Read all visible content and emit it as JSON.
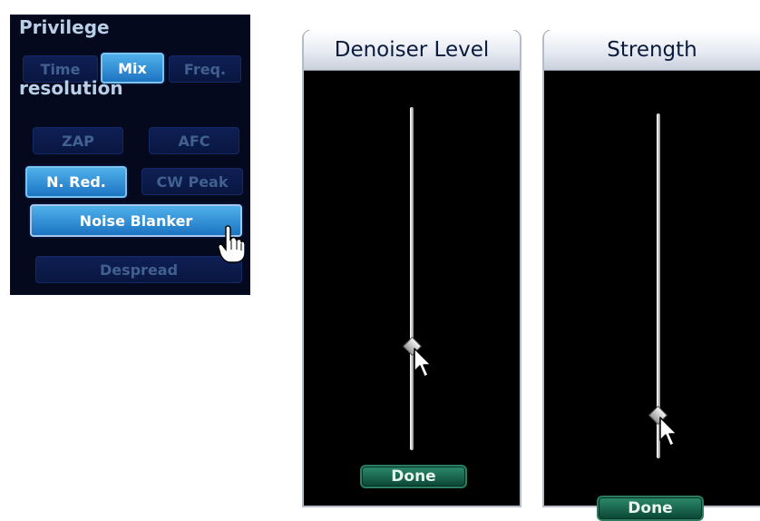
{
  "privilege_panel": {
    "title_line1": "Privilege",
    "title_line2": "resolution",
    "resolution_buttons": [
      "Time",
      "Mix",
      "Freq."
    ],
    "selected_resolution": "Mix",
    "buttons": {
      "zap": "ZAP",
      "afc": "AFC",
      "n_red": "N. Red.",
      "cw_peak": "CW Peak",
      "noise_blanker": "Noise Blanker",
      "despread": "Despread"
    },
    "active_buttons": [
      "N. Red.",
      "Noise Blanker"
    ]
  },
  "denoiser_dialog": {
    "title": "Denoiser Level",
    "done_label": "Done",
    "slider_level_fraction": 0.31
  },
  "strength_dialog": {
    "title": "Strength",
    "done_label": "Done",
    "slider_level_fraction": 0.15
  },
  "colors": {
    "panel_bg": "#05091d",
    "active_button": "#3b9be0",
    "inactive_text": "#41608f",
    "done_button": "#1d6b55"
  }
}
